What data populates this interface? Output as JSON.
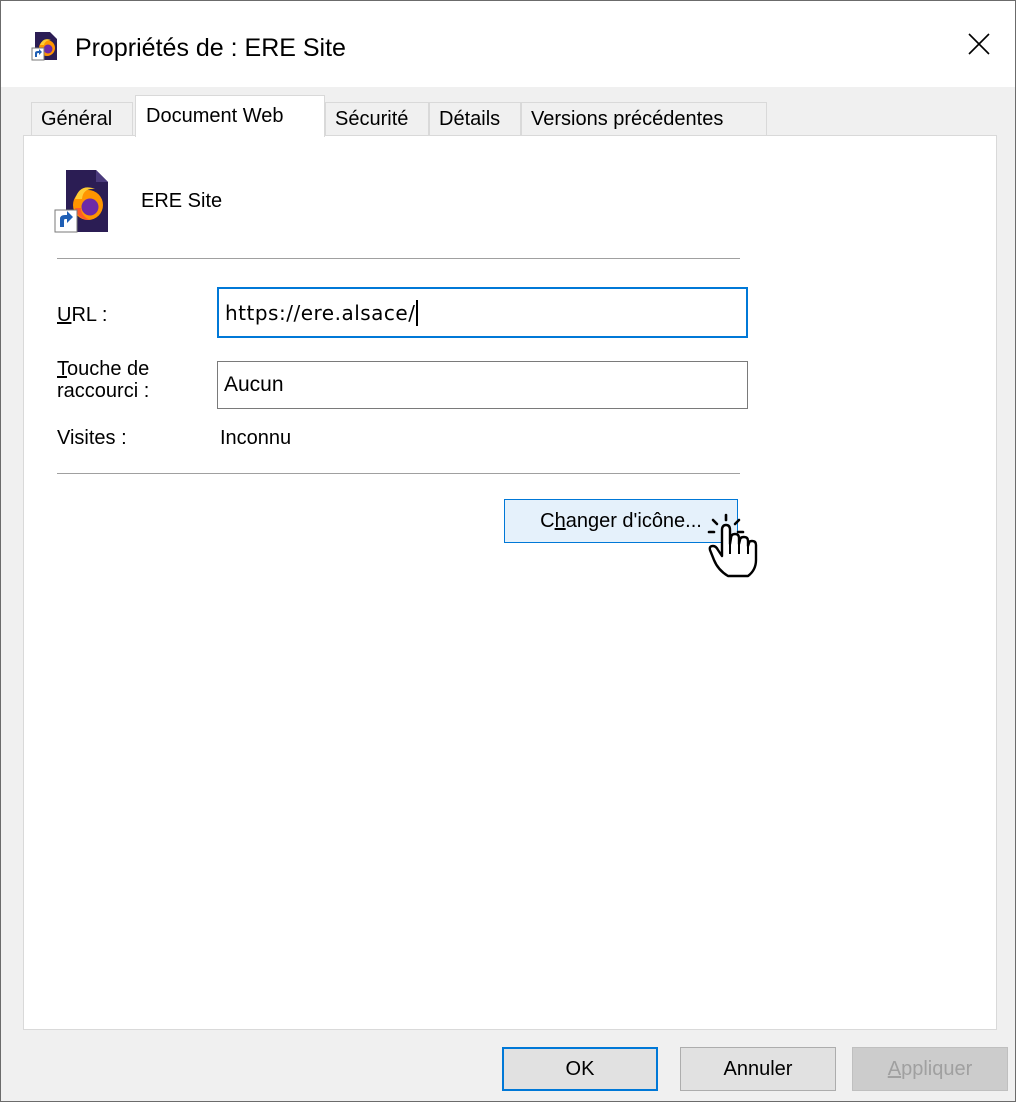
{
  "window": {
    "title": "Propriétés de : ERE Site",
    "close_glyph": "✕"
  },
  "tabs": [
    {
      "label": "Général",
      "active": false
    },
    {
      "label": "Document Web",
      "active": true
    },
    {
      "label": "Sécurité",
      "active": false
    },
    {
      "label": "Détails",
      "active": false
    },
    {
      "label": "Versions précédentes",
      "active": false
    }
  ],
  "shortcut": {
    "name": "ERE Site",
    "icon": "firefox-shortcut-icon"
  },
  "fields": {
    "url": {
      "label_mnemonic": "U",
      "label_rest": "RL :",
      "value": "https://ere.alsace/"
    },
    "hotkey": {
      "label_mnemonic": "T",
      "label_line1_rest": "ouche de",
      "label_line2": "raccourci :",
      "value": "Aucun"
    },
    "visits": {
      "label": "Visites :",
      "value": "Inconnu"
    }
  },
  "change_icon_button": {
    "before": "C",
    "mnemonic": "h",
    "after": "anger d'icône..."
  },
  "footer": {
    "ok": "OK",
    "cancel": "Annuler",
    "apply_mnemonic": "A",
    "apply_rest": "ppliquer"
  },
  "colors": {
    "accent": "#0078d7",
    "firefox_orange": "#ff9500",
    "firefox_purple": "#6e2aa6"
  }
}
